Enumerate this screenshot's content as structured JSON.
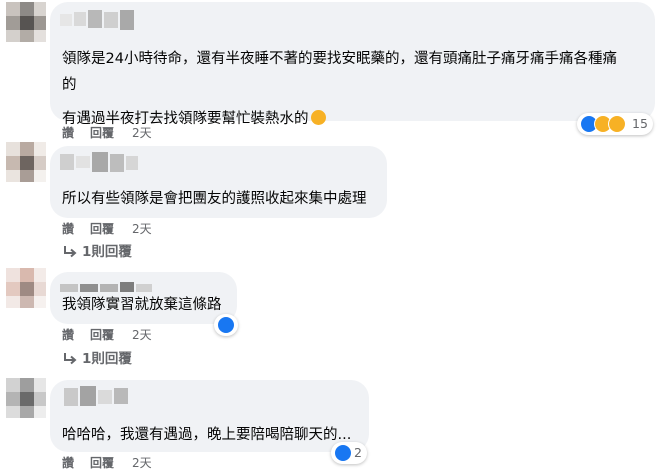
{
  "comments": [
    {
      "lines": [
        "領隊是24小時待命，還有半夜睡不著的要找安眠藥的，還有頭痛肚子痛牙痛手痛各種痛",
        "的",
        "有遇過半夜打去找領隊要幫忙裝熱水的"
      ],
      "actions": {
        "like": "讚",
        "reply": "回覆",
        "time": "2天"
      },
      "reactions": {
        "icons": [
          "like-icon",
          "wow-icon",
          "care-icon"
        ],
        "count": "15"
      }
    },
    {
      "lines": [
        "所以有些領隊是會把團友的護照收起來集中處理"
      ],
      "actions": {
        "like": "讚",
        "reply": "回覆",
        "time": "2天"
      },
      "replies": "1則回覆"
    },
    {
      "lines": [
        "我領隊實習就放棄這條路"
      ],
      "actions": {
        "like": "讚",
        "reply": "回覆",
        "time": "2天"
      },
      "reactions": {
        "icons": [
          "like-icon"
        ],
        "count": ""
      },
      "replies": "1則回覆"
    },
    {
      "lines": [
        "哈哈哈，我還有遇過，晚上要陪喝陪聊天的..."
      ],
      "actions": {
        "like": "讚",
        "reply": "回覆",
        "time": "2天"
      },
      "reactions": {
        "icons": [
          "like-icon"
        ],
        "count": "2"
      }
    }
  ],
  "colors": {
    "bubble": "#f0f2f5",
    "meta": "#65676b",
    "like": "#1877f2",
    "emoji": "#f7b125"
  }
}
